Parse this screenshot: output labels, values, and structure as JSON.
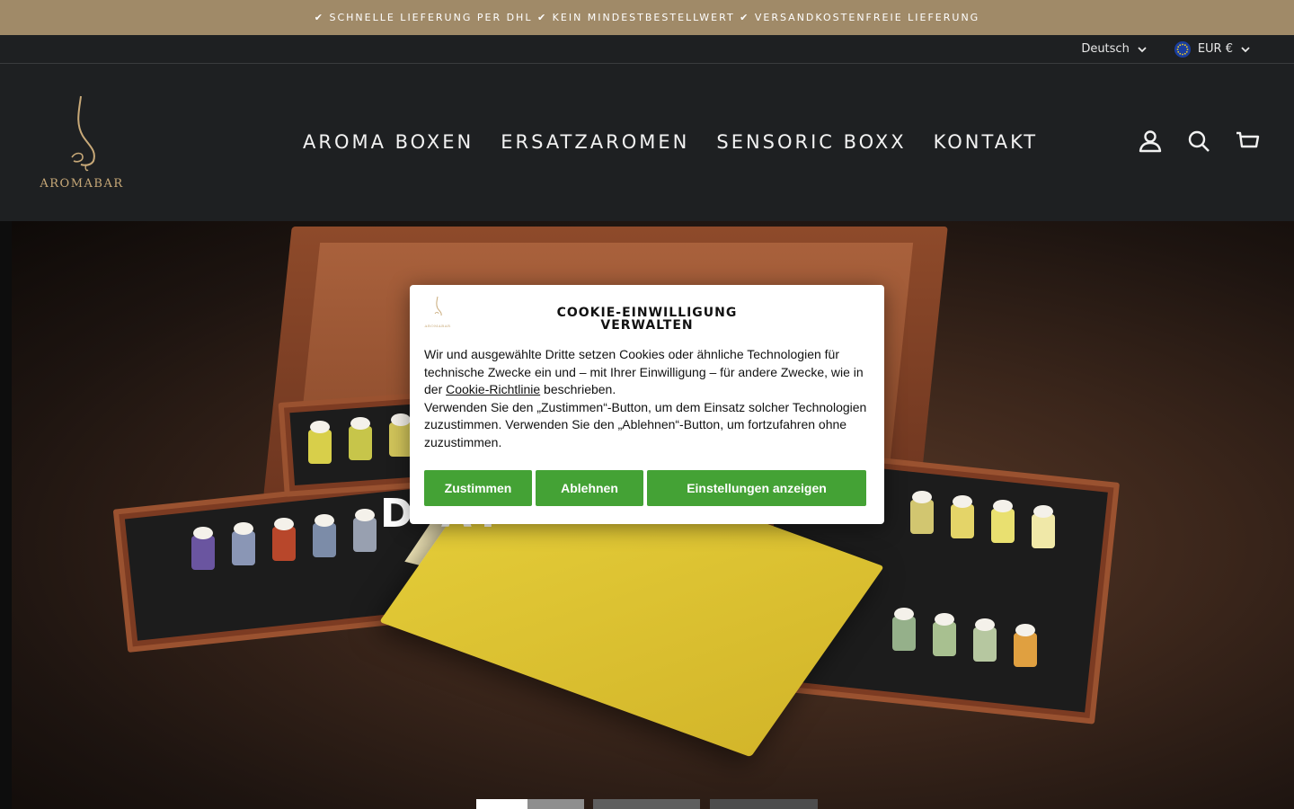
{
  "announcement": {
    "text": "✔ SCHNELLE LIEFERUNG PER DHL ✔ KEIN MINDESTBESTELLWERT ✔ VERSANDKOSTENFREIE LIEFERUNG"
  },
  "utility": {
    "language": "Deutsch",
    "currency": "EUR €"
  },
  "header": {
    "logo_text": "AROMABAR",
    "nav": [
      "AROMA BOXEN",
      "ERSATZAROMEN",
      "SENSORIC BOXX",
      "KONTAKT"
    ],
    "icons": [
      "account-icon",
      "search-icon",
      "cart-icon"
    ]
  },
  "hero": {
    "title_partial": "D                          A!"
  },
  "cookie": {
    "title_line1": "COOKIE-EINWILLIGUNG",
    "title_line2": "VERWALTEN",
    "logo_text": "AROMABAR",
    "body_part1": "Wir und ausgewählte Dritte setzen Cookies oder ähnliche Technologien für technische Zwecke ein und – mit Ihrer Einwilligung – für andere Zwecke, wie in der ",
    "policy_link": "Cookie-Richtlinie",
    "body_part2": " beschrieben.",
    "body_part3": "Verwenden Sie den „Zustimmen“-Button, um dem Einsatz solcher Technologien zuzustimmen. Verwenden Sie den „Ablehnen“-Button, um fortzufahren ohne zuzustimmen.",
    "accept_label": "Zustimmen",
    "reject_label": "Ablehnen",
    "settings_label": "Einstellungen anzeigen"
  },
  "colors": {
    "announcement_bg": "#a08a68",
    "header_bg": "#1e2022",
    "brand_gold": "#c8a978",
    "button_green": "#44a235"
  }
}
